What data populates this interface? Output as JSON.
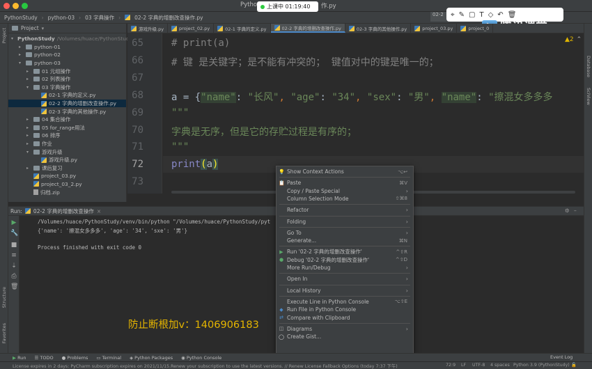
{
  "window": {
    "title": "PythonStudy – 02-2 字典的增删改查操作.py",
    "title_short": "Pytho",
    "title_tail": "作.py"
  },
  "class_badge": {
    "label": "上课中 01:19:40"
  },
  "navbar": {
    "crumbs": [
      "PythonStudy",
      "python-03",
      "03 字典操作",
      "02-2 字典的增删改查操作.py"
    ],
    "run_config": "02-2"
  },
  "project_panel": {
    "title": "Project",
    "items": [
      {
        "label": "PythonStudy",
        "extra": "/Volumes/huace/PythonStudy",
        "level": 0,
        "kind": "folder",
        "open": true
      },
      {
        "label": "python-01",
        "level": 1,
        "kind": "folder",
        "open": false
      },
      {
        "label": "python-02",
        "level": 1,
        "kind": "folder",
        "open": false
      },
      {
        "label": "python-03",
        "level": 1,
        "kind": "folder",
        "open": true
      },
      {
        "label": "01 元组操作",
        "level": 2,
        "kind": "folder",
        "open": false
      },
      {
        "label": "02 列表操作",
        "level": 2,
        "kind": "folder",
        "open": false
      },
      {
        "label": "03 字典操作",
        "level": 2,
        "kind": "folder",
        "open": true
      },
      {
        "label": "02-1 字典的定义.py",
        "level": 3,
        "kind": "py"
      },
      {
        "label": "02-2 字典的增删改查操作.py",
        "level": 3,
        "kind": "py",
        "selected": true
      },
      {
        "label": "02-3 字典的其他操作.py",
        "level": 3,
        "kind": "py"
      },
      {
        "label": "04 集合操作",
        "level": 2,
        "kind": "folder",
        "open": false
      },
      {
        "label": "05 for_range用法",
        "level": 2,
        "kind": "folder",
        "open": false
      },
      {
        "label": "06 排序",
        "level": 2,
        "kind": "folder",
        "open": false
      },
      {
        "label": "作业",
        "level": 2,
        "kind": "folder",
        "open": false
      },
      {
        "label": "游戏升级",
        "level": 2,
        "kind": "folder",
        "open": true
      },
      {
        "label": "游戏升级.py",
        "level": 3,
        "kind": "py"
      },
      {
        "label": "课后复习",
        "level": 2,
        "kind": "folder",
        "open": false
      },
      {
        "label": "project_03.py",
        "level": 2,
        "kind": "py"
      },
      {
        "label": "project_03_2.py",
        "level": 2,
        "kind": "py"
      },
      {
        "label": "归档.zip",
        "level": 2,
        "kind": "zip"
      }
    ]
  },
  "tabs": [
    "游戏升级.py",
    "project_02.py",
    "02-1 字典的定义.py",
    "02-2 字典的增删改查操作.py",
    "02-3 字典的其他操作.py",
    "project_03.py",
    "project_0"
  ],
  "editor": {
    "line_numbers": [
      "65",
      "66",
      "67",
      "68",
      "69",
      "70",
      "71",
      "72",
      "73"
    ],
    "lines": {
      "l65": "# print(a)",
      "l66": "# 键 是关键字；是不能有冲突的； 键值对中的键是唯一的；",
      "l68_a": "a = {",
      "l68_k1": "\"name\"",
      "l68_c1": ": ",
      "l68_v1": "\"长风\"",
      "l68_c2": ", ",
      "l68_k2": "\"age\"",
      "l68_c3": ": ",
      "l68_v2": "\"34\"",
      "l68_c4": ", ",
      "l68_k3": "\"sex\"",
      "l68_c5": ": ",
      "l68_v3": "\"男\"",
      "l68_c6": ", ",
      "l68_k4": "\"name\"",
      "l68_c7": ": ",
      "l68_v4": "\"擦混女多多多",
      "l69": "\"\"\"",
      "l70": "字典是无序，但是它的存贮过程是有序的；",
      "l71": "\"\"\"",
      "l72_fn": "print",
      "l72_p1": "(",
      "l72_arg": "a",
      "l72_p2": ")"
    },
    "warnings": "▲2"
  },
  "run_panel": {
    "label": "Run:",
    "config": "02-2 字典的增删改查操作",
    "lines": [
      "/Volumes/huace/PythonStudy/venv/bin/python \"/Volumes/huace/PythonStudy/pyt",
      "{'name': '擦混女多多多', 'age': '34', 'sxe': '男'}",
      "",
      "Process finished with exit code 0"
    ]
  },
  "context_menu": {
    "items": [
      {
        "label": "Show Context Actions",
        "shortcut": "⌥↩",
        "icon": "bulb"
      },
      {
        "sep": true
      },
      {
        "label": "Paste",
        "shortcut": "⌘V",
        "icon": "paste"
      },
      {
        "label": "Copy / Paste Special",
        "submenu": true
      },
      {
        "label": "Column Selection Mode",
        "shortcut": "⇧⌘8"
      },
      {
        "sep": true
      },
      {
        "label": "Refactor",
        "submenu": true
      },
      {
        "sep": true
      },
      {
        "label": "Folding",
        "submenu": true
      },
      {
        "sep": true
      },
      {
        "label": "Go To",
        "submenu": true
      },
      {
        "label": "Generate...",
        "shortcut": "⌘N"
      },
      {
        "sep": true
      },
      {
        "label": "Run '02-2 字典的增删改查操作'",
        "shortcut": "^⇧R",
        "icon": "run"
      },
      {
        "label": "Debug '02-2 字典的增删改查操作'",
        "shortcut": "^⇧D",
        "icon": "debug"
      },
      {
        "label": "More Run/Debug",
        "submenu": true
      },
      {
        "sep": true
      },
      {
        "label": "Open In",
        "submenu": true
      },
      {
        "sep": true
      },
      {
        "label": "Local History",
        "submenu": true
      },
      {
        "sep": true
      },
      {
        "label": "Execute Line in Python Console",
        "shortcut": "⌥⇧E"
      },
      {
        "label": "Run File in Python Console",
        "icon": "python"
      },
      {
        "label": "Compare with Clipboard",
        "icon": "compare"
      },
      {
        "sep": true
      },
      {
        "label": "Diagrams",
        "submenu": true,
        "icon": "diagram"
      },
      {
        "label": "Create Gist...",
        "icon": "github"
      }
    ]
  },
  "watermark": "防止断根加v：1406906183",
  "tencent_logo": "腾讯课堂",
  "bottom_tabs": [
    "Run",
    "TODO",
    "Problems",
    "Terminal",
    "Python Packages",
    "Python Console"
  ],
  "event_log": "Event Log",
  "status": {
    "message": "License expires in 2 days: PyCharm subscription expires on 2021/11/15.Renew your subscription to use the latest versions. // Renew License   Fallback Options (today 7:37 下午)",
    "position": "72:9",
    "line_sep": "LF",
    "encoding": "UTF-8",
    "indent": "4 spaces",
    "interpreter": "Python 3.9 (PythonStudy)"
  },
  "side_labels": {
    "project": "Project",
    "structure": "Structure",
    "favorites": "Favorites",
    "database": "Database",
    "sciview": "SciView"
  },
  "colors": {
    "accent": "#4a88c7",
    "comment": "#808080",
    "string": "#6a8759",
    "keyword": "#cc7832",
    "watermark": "#e5b500"
  }
}
